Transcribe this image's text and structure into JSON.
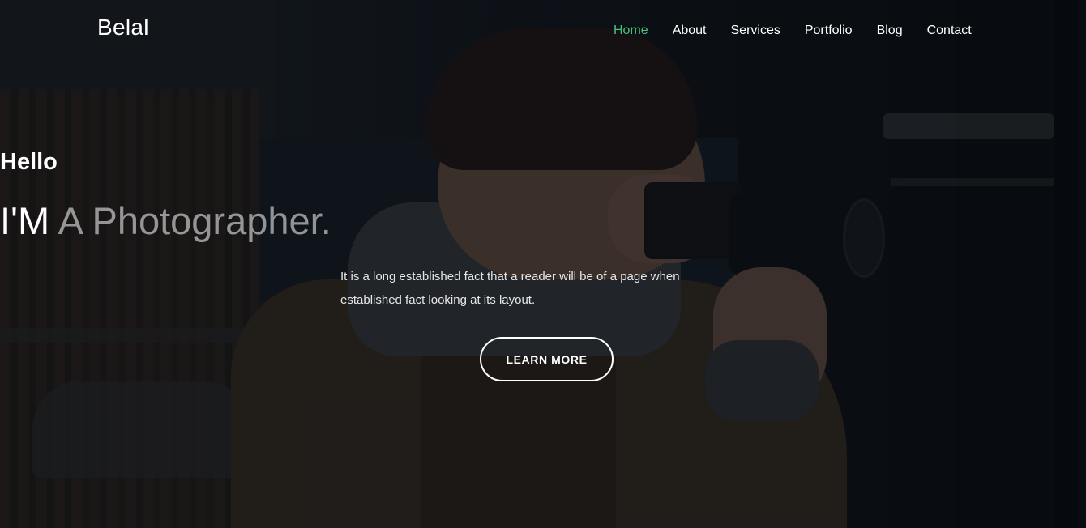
{
  "brand": {
    "name": "Belal"
  },
  "nav": {
    "items": [
      {
        "label": "Home",
        "active": true
      },
      {
        "label": "About",
        "active": false
      },
      {
        "label": "Services",
        "active": false
      },
      {
        "label": "Portfolio",
        "active": false
      },
      {
        "label": "Blog",
        "active": false
      },
      {
        "label": "Contact",
        "active": false
      }
    ]
  },
  "hero": {
    "greeting": "Hello",
    "headline_prefix": "I'M",
    "headline_role": "A Photographer.",
    "description_line1": "It is a long established fact that a reader will be of a page when",
    "description_line2": "established fact looking at its layout.",
    "cta_label": "LEARN MORE"
  },
  "colors": {
    "accent_active_nav": "#47c27a",
    "overlay": "rgba(8,12,16,0.62)"
  }
}
